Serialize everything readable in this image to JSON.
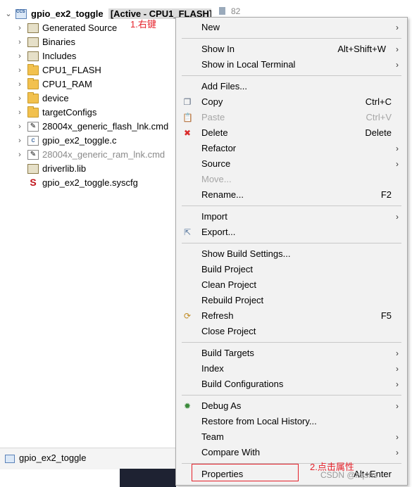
{
  "project_tree": {
    "project_name": "gpio_ex2_toggle",
    "active_config": "[Active - CPU1_FLASH]",
    "items": [
      {
        "label": "Generated Source",
        "icon": "generated-source-icon",
        "disabled": false
      },
      {
        "label": "Binaries",
        "icon": "binaries-icon",
        "disabled": false
      },
      {
        "label": "Includes",
        "icon": "includes-icon",
        "disabled": false
      },
      {
        "label": "CPU1_FLASH",
        "icon": "folder-icon",
        "disabled": false
      },
      {
        "label": "CPU1_RAM",
        "icon": "folder-icon",
        "disabled": false
      },
      {
        "label": "device",
        "icon": "folder-icon",
        "disabled": false
      },
      {
        "label": "targetConfigs",
        "icon": "folder-icon",
        "disabled": false
      },
      {
        "label": "28004x_generic_flash_lnk.cmd",
        "icon": "linker-file-icon",
        "disabled": false
      },
      {
        "label": "gpio_ex2_toggle.c",
        "icon": "c-file-icon",
        "disabled": false
      },
      {
        "label": "28004x_generic_ram_lnk.cmd",
        "icon": "linker-file-icon",
        "disabled": true
      },
      {
        "label": "driverlib.lib",
        "icon": "library-icon",
        "disabled": false
      },
      {
        "label": "gpio_ex2_toggle.syscfg",
        "icon": "syscfg-icon",
        "disabled": false
      }
    ]
  },
  "annotations": {
    "right_click": "1.右键",
    "click_properties": "2.点击属性"
  },
  "editor": {
    "line_number": "82"
  },
  "bottom_bar": {
    "label": "gpio_ex2_toggle"
  },
  "context_menu": {
    "groups": [
      [
        {
          "label": "New",
          "accel": "",
          "submenu": true,
          "disabled": false,
          "icon": ""
        }
      ],
      [
        {
          "label": "Show In",
          "accel": "Alt+Shift+W",
          "submenu": true,
          "disabled": false,
          "icon": ""
        },
        {
          "label": "Show in Local Terminal",
          "accel": "",
          "submenu": true,
          "disabled": false,
          "icon": ""
        }
      ],
      [
        {
          "label": "Add Files...",
          "accel": "",
          "submenu": false,
          "disabled": false,
          "icon": ""
        },
        {
          "label": "Copy",
          "accel": "Ctrl+C",
          "submenu": false,
          "disabled": false,
          "icon": "copy-icon"
        },
        {
          "label": "Paste",
          "accel": "Ctrl+V",
          "submenu": false,
          "disabled": true,
          "icon": "paste-icon"
        },
        {
          "label": "Delete",
          "accel": "Delete",
          "submenu": false,
          "disabled": false,
          "icon": "delete-icon"
        },
        {
          "label": "Refactor",
          "accel": "",
          "submenu": true,
          "disabled": false,
          "icon": ""
        },
        {
          "label": "Source",
          "accel": "",
          "submenu": true,
          "disabled": false,
          "icon": ""
        },
        {
          "label": "Move...",
          "accel": "",
          "submenu": false,
          "disabled": true,
          "icon": ""
        },
        {
          "label": "Rename...",
          "accel": "F2",
          "submenu": false,
          "disabled": false,
          "icon": ""
        }
      ],
      [
        {
          "label": "Import",
          "accel": "",
          "submenu": true,
          "disabled": false,
          "icon": ""
        },
        {
          "label": "Export...",
          "accel": "",
          "submenu": false,
          "disabled": false,
          "icon": "export-icon"
        }
      ],
      [
        {
          "label": "Show Build Settings...",
          "accel": "",
          "submenu": false,
          "disabled": false,
          "icon": ""
        },
        {
          "label": "Build Project",
          "accel": "",
          "submenu": false,
          "disabled": false,
          "icon": ""
        },
        {
          "label": "Clean Project",
          "accel": "",
          "submenu": false,
          "disabled": false,
          "icon": ""
        },
        {
          "label": "Rebuild Project",
          "accel": "",
          "submenu": false,
          "disabled": false,
          "icon": ""
        },
        {
          "label": "Refresh",
          "accel": "F5",
          "submenu": false,
          "disabled": false,
          "icon": "refresh-icon"
        },
        {
          "label": "Close Project",
          "accel": "",
          "submenu": false,
          "disabled": false,
          "icon": ""
        }
      ],
      [
        {
          "label": "Build Targets",
          "accel": "",
          "submenu": true,
          "disabled": false,
          "icon": ""
        },
        {
          "label": "Index",
          "accel": "",
          "submenu": true,
          "disabled": false,
          "icon": ""
        },
        {
          "label": "Build Configurations",
          "accel": "",
          "submenu": true,
          "disabled": false,
          "icon": ""
        }
      ],
      [
        {
          "label": "Debug As",
          "accel": "",
          "submenu": true,
          "disabled": false,
          "icon": "debug-icon"
        },
        {
          "label": "Restore from Local History...",
          "accel": "",
          "submenu": false,
          "disabled": false,
          "icon": ""
        },
        {
          "label": "Team",
          "accel": "",
          "submenu": true,
          "disabled": false,
          "icon": ""
        },
        {
          "label": "Compare With",
          "accel": "",
          "submenu": true,
          "disabled": false,
          "icon": ""
        }
      ],
      [
        {
          "label": "Properties",
          "accel": "Alt+Enter",
          "submenu": false,
          "disabled": false,
          "icon": ""
        }
      ]
    ]
  },
  "watermark": "CSDN @ltqshs",
  "colors": {
    "annotation_red": "#e5212a",
    "menu_background": "#f2f2f2",
    "disabled_text": "#a6a6a6"
  }
}
